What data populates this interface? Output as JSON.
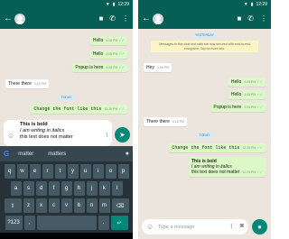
{
  "status": {
    "time": "12:29"
  },
  "left": {
    "messages": [
      {
        "text": "Hello",
        "time": "4:08 PM",
        "ticks": "✓✓"
      },
      {
        "text": "Hello",
        "time": "4:08 PM",
        "ticks": "✓✓"
      },
      {
        "text": "Popup is here",
        "time": "4:08 PM",
        "ticks": "✓✓"
      },
      {
        "text": "There there",
        "time": "4:15 PM"
      },
      {
        "text": "Change the font like this",
        "time": "12:28 PM",
        "ticks": "✓✓"
      }
    ],
    "date_pill": "TODAY",
    "composer": {
      "line1": "This is bold",
      "line2": "I am writing in italics",
      "line3": "this text does not matter"
    },
    "suggestions": [
      "matter",
      "matters"
    ],
    "keys": {
      "row1": [
        "q",
        "w",
        "e",
        "r",
        "t",
        "y",
        "u",
        "i",
        "o",
        "p"
      ],
      "row2": [
        "a",
        "s",
        "d",
        "f",
        "g",
        "h",
        "j",
        "k",
        "l"
      ],
      "row3": [
        "z",
        "x",
        "c",
        "v",
        "b",
        "n",
        "m"
      ],
      "shift": "⇧",
      "backspace": "⌫",
      "sym": "?123",
      "comma": ",",
      "period": ".",
      "enter": "↵"
    }
  },
  "right": {
    "date_top": "YESTERDAY",
    "notice": "Messages to this chat and calls are now secured with end-to-end encryption. Tap for more info.",
    "messages": [
      {
        "text": "Hey",
        "time": "4:05 PM"
      },
      {
        "text": "Hello",
        "time": "4:05 PM",
        "ticks": "✓✓"
      },
      {
        "text": "Hello",
        "time": "4:08 PM",
        "ticks": "✓✓"
      },
      {
        "text": "Popup is here",
        "time": "4:08 PM",
        "ticks": "✓✓"
      },
      {
        "text": "There there",
        "time": "4:15 PM"
      },
      {
        "text": "Change the font like this",
        "time": "12:28 PM",
        "ticks": "✓✓"
      }
    ],
    "date_pill": "TODAY",
    "formatted": {
      "line1": "This is bold",
      "line2": "I am writing in italics",
      "line3": "this text does not matter",
      "time": "12:29 PM",
      "ticks": "✓✓"
    },
    "composer_placeholder": "Type a message"
  },
  "icons": {
    "back": "←",
    "video": "■",
    "call": "✆",
    "more": "⋮",
    "smiley": "☺",
    "clip": "⌇",
    "camera": "◙",
    "send": "➤",
    "mic": "●"
  },
  "colors": {
    "header": "#075e54",
    "accent": "#00897b",
    "outgoing": "#dcf8c6",
    "chat_bg": "#ece5dd",
    "keyboard": "#263238"
  }
}
